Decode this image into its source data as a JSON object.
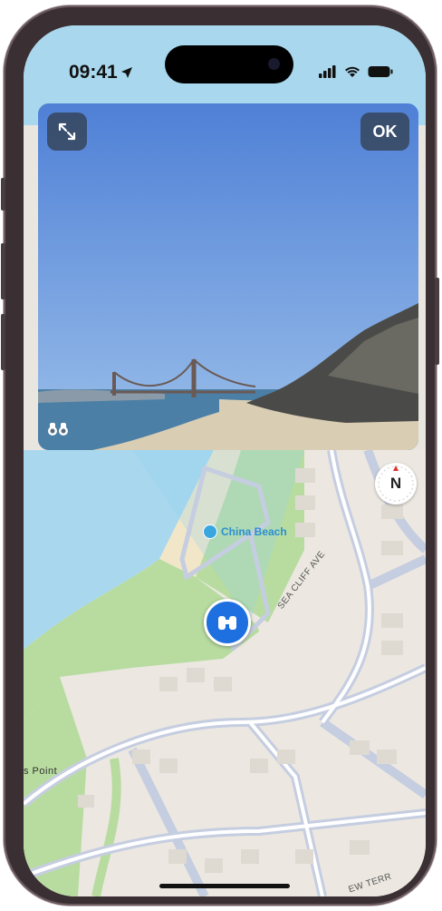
{
  "status_bar": {
    "time": "09:41"
  },
  "look_around": {
    "ok_label": "OK"
  },
  "map": {
    "compass_label": "N",
    "poi_label": "China Beach",
    "road_labels": {
      "sea_cliff": "SEA CLIFF AVE",
      "point": "s Point",
      "terr": "EW TERR"
    }
  },
  "colors": {
    "accent": "#1e6fe0",
    "water": "#a9d8ee",
    "park": "#b8dca0"
  }
}
